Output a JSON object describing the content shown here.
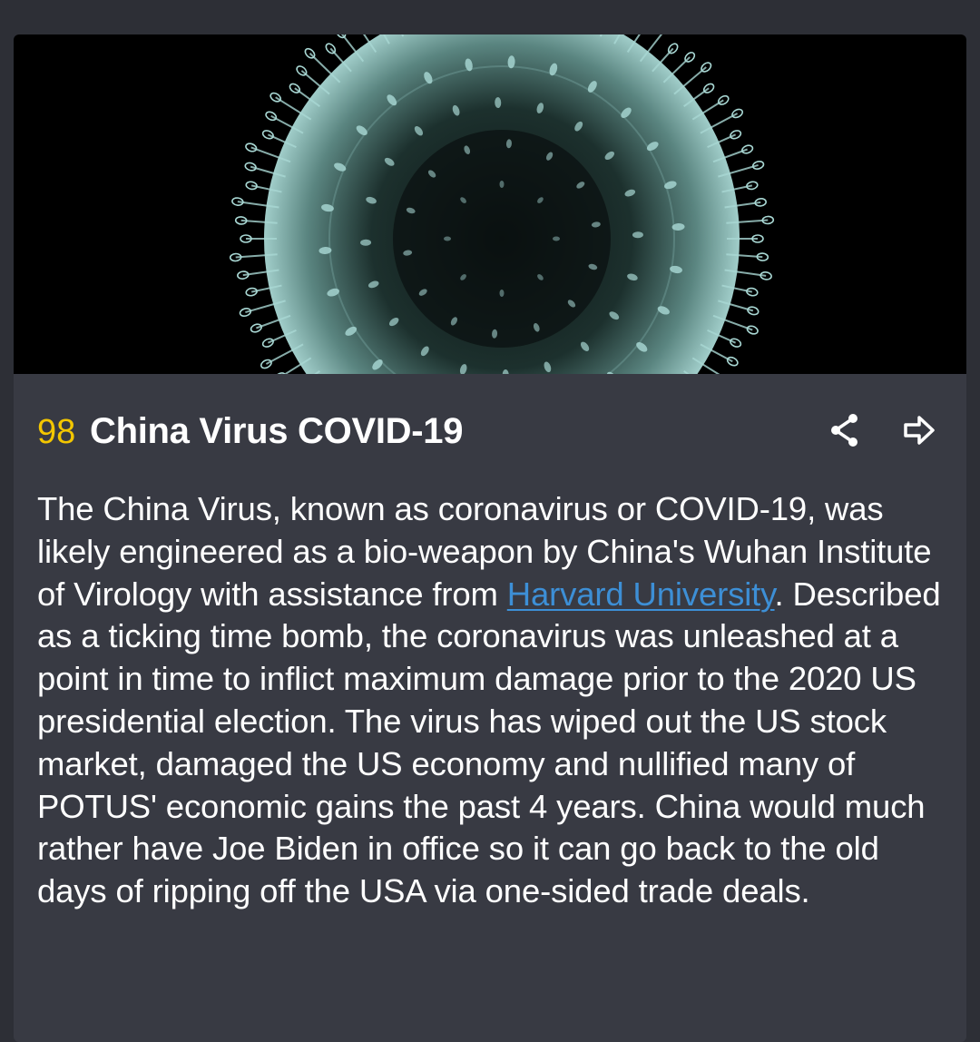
{
  "card": {
    "image_alt": "coronavirus-particle-image",
    "rank": "98",
    "title": "China Virus COVID-19",
    "actions": {
      "share_icon": "share-icon",
      "open_icon": "arrow-right-icon"
    },
    "body": {
      "part1": "The China Virus, known as coronavirus or COVID-19, was likely engineered as a bio-weapon by China's Wuhan Institute of Virology with assistance from ",
      "link_text": "Harvard University",
      "part2": ".  Described as a ticking time bomb, the coronavirus was unleashed at a point in time to inflict maximum damage prior to the 2020 US presidential election. The virus has wiped out the US stock market, damaged the US economy and nullified many of POTUS' economic gains the past 4 years. China would much rather have Joe Biden in office so it can go back to the old days of ripping off the USA via one-sided trade deals."
    }
  },
  "colors": {
    "background": "#2d2f36",
    "card": "#383a43",
    "rank": "#f3c600",
    "link": "#3d8fd6",
    "virus": "#a9d8d4"
  }
}
